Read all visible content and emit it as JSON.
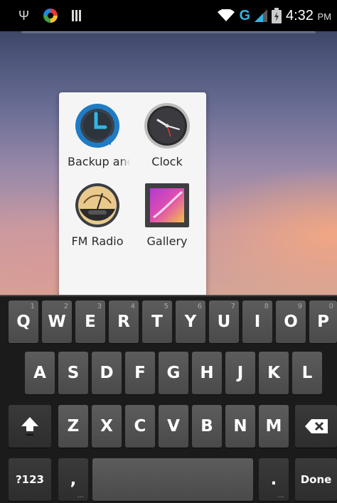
{
  "status_bar": {
    "network_label": "G",
    "time": "4:32",
    "ampm": "PM",
    "icons": [
      "usb-icon",
      "sync-icon",
      "bars-icon",
      "wifi-icon",
      "signal-icon",
      "battery-icon"
    ]
  },
  "folder": {
    "apps": [
      {
        "label": "Backup and R",
        "icon": "backup-icon"
      },
      {
        "label": "Clock",
        "icon": "clock-icon"
      },
      {
        "label": "FM Radio",
        "icon": "fm-radio-icon"
      },
      {
        "label": "Gallery",
        "icon": "gallery-icon"
      }
    ]
  },
  "keyboard": {
    "row1": [
      {
        "key": "Q",
        "hint": "1"
      },
      {
        "key": "W",
        "hint": "2"
      },
      {
        "key": "E",
        "hint": "3"
      },
      {
        "key": "R",
        "hint": "4"
      },
      {
        "key": "T",
        "hint": "5"
      },
      {
        "key": "Y",
        "hint": "6"
      },
      {
        "key": "U",
        "hint": "7"
      },
      {
        "key": "I",
        "hint": "8"
      },
      {
        "key": "O",
        "hint": "9"
      },
      {
        "key": "P",
        "hint": "0"
      }
    ],
    "row2": [
      "A",
      "S",
      "D",
      "F",
      "G",
      "H",
      "J",
      "K",
      "L"
    ],
    "row3": [
      "Z",
      "X",
      "C",
      "V",
      "B",
      "N",
      "M"
    ],
    "symbols_label": "?123",
    "comma_label": ",",
    "period_label": ".",
    "done_label": "Done",
    "sub_hint": "..."
  },
  "colors": {
    "accent": "#33b5e5",
    "key_bg": "#4f4f4f",
    "keyboard_bg": "#1b1b1b",
    "folder_bg": "#f5f5f5"
  }
}
